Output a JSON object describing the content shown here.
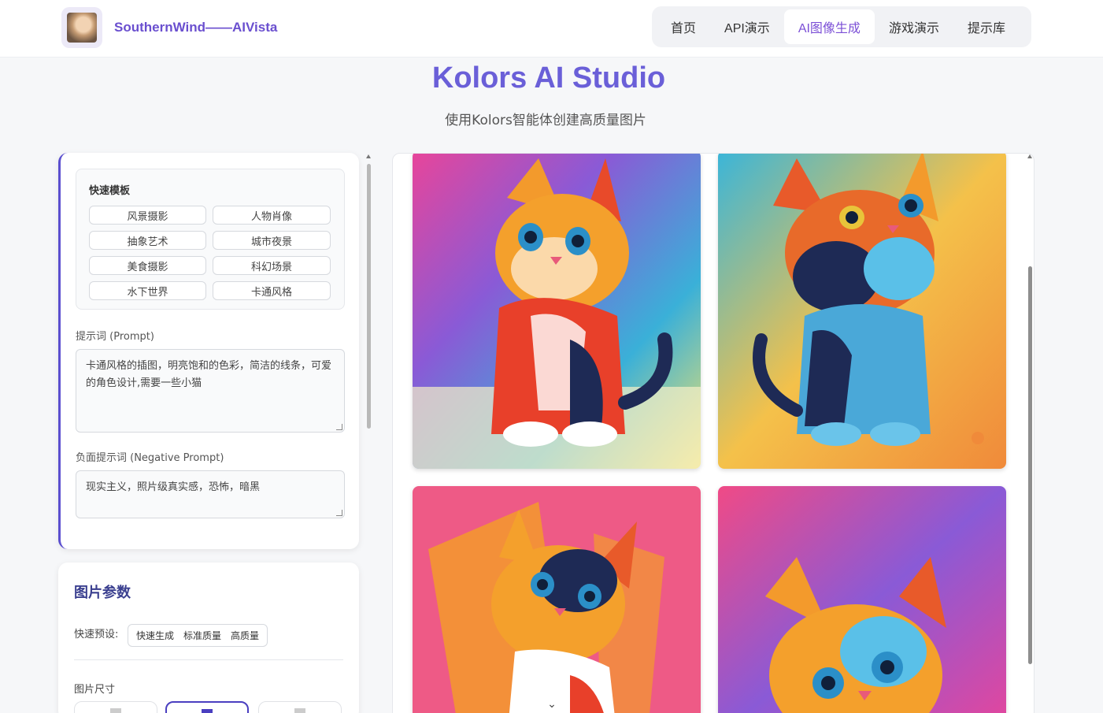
{
  "header": {
    "brand": "SouthernWind——AIVista",
    "nav": [
      {
        "label": "首页",
        "active": false
      },
      {
        "label": "API演示",
        "active": false
      },
      {
        "label": "AI图像生成",
        "active": true
      },
      {
        "label": "游戏演示",
        "active": false
      },
      {
        "label": "提示库",
        "active": false
      }
    ]
  },
  "hero": {
    "title": "Kolors AI Studio",
    "subtitle": "使用Kolors智能体创建高质量图片"
  },
  "templates": {
    "title": "快速模板",
    "items": [
      "风景摄影",
      "人物肖像",
      "抽象艺术",
      "城市夜景",
      "美食摄影",
      "科幻场景",
      "水下世界",
      "卡通风格"
    ]
  },
  "prompt": {
    "label": "提示词 (Prompt)",
    "value": "卡通风格的插图，明亮饱和的色彩，简洁的线条，可爱的角色设计,需要一些小猫"
  },
  "negative_prompt": {
    "label": "负面提示词 (Negative Prompt)",
    "value": "现实主义，照片级真实感，恐怖，暗黑"
  },
  "params": {
    "title": "图片参数",
    "preset_label": "快速预设:",
    "presets": [
      "快速生成",
      "标准质量",
      "高质量"
    ],
    "size_label": "图片尺寸",
    "selected_size_index": 1
  },
  "gallery": {
    "image_count": 4,
    "images": [
      "kitten-image",
      "kitten-image",
      "kitten-image",
      "kitten-image"
    ]
  },
  "colors": {
    "accent": "#6a5fd8",
    "nav_active": "#7b4fd6",
    "brand": "#6a4fcf"
  }
}
